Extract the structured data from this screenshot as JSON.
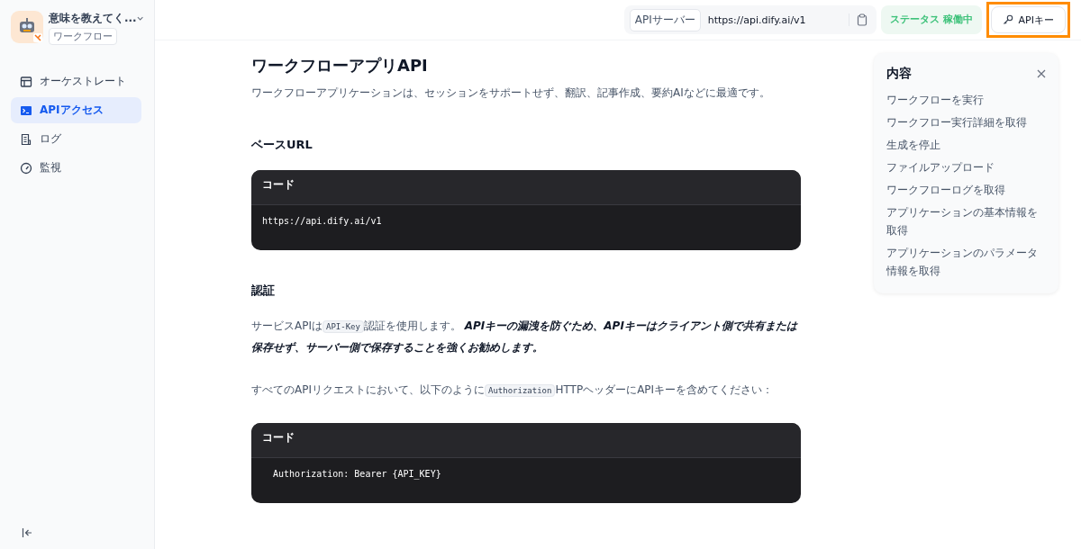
{
  "app": {
    "name": "意味を教えてく...",
    "badge": "ワークフロー"
  },
  "nav": [
    {
      "label": "オーケストレート",
      "selected": false
    },
    {
      "label": "APIアクセス",
      "selected": true
    },
    {
      "label": "ログ",
      "selected": false
    },
    {
      "label": "監視",
      "selected": false
    }
  ],
  "topbar": {
    "server_label": "APIサーバー",
    "server_url": "https://api.dify.ai/v1",
    "status_label": "ステータス",
    "status_value": "稼働中",
    "api_key_button": {
      "label": "APIキー",
      "highlighted": true
    }
  },
  "doc": {
    "title": "ワークフローアプリAPI",
    "intro": "ワークフローアプリケーションは、セッションをサポートせず、翻訳、記事作成、要約AIなどに最適です。",
    "sections": [
      {
        "kind": "code",
        "heading": "ベースURL",
        "code_label": "コード",
        "code": "https://api.dify.ai/v1"
      },
      {
        "kind": "text",
        "heading": "認証",
        "paragraphs": [
          [
            {
              "kind": "text",
              "text": "サービスAPIは"
            },
            {
              "kind": "code",
              "text": "API-Key"
            },
            {
              "kind": "text",
              "text": "認証を使用します。 "
            },
            {
              "kind": "emphasis",
              "text": "APIキーの漏洩を防ぐため、APIキーはクライアント側で共有または保存せず、サーバー側で保存することを強くお勧めします。"
            }
          ],
          [
            {
              "kind": "text",
              "text": "すべてのAPIリクエストにおいて、以下のように"
            },
            {
              "kind": "code",
              "text": "Authorization"
            },
            {
              "kind": "text",
              "text": "HTTPヘッダーにAPIキーを含めてください："
            }
          ]
        ]
      },
      {
        "kind": "code",
        "code_label": "コード",
        "code": "  Authorization: Bearer {API_KEY}"
      }
    ]
  },
  "toc": {
    "title": "内容",
    "items": [
      "ワークフローを実行",
      "ワークフロー実行詳細を取得",
      "生成を停止",
      "ファイルアップロード",
      "ワークフローログを取得",
      "アプリケーションの基本情報を取得",
      "アプリケーションのパラメータ情報を取得"
    ]
  }
}
